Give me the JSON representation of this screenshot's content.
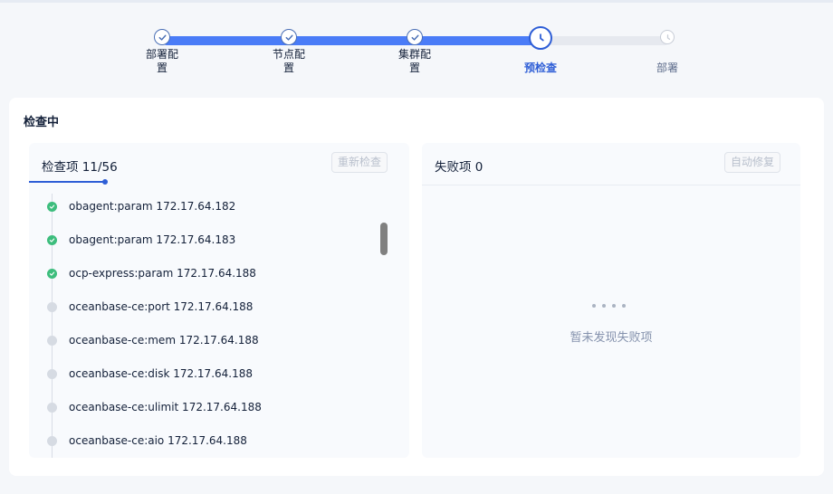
{
  "stepper": {
    "steps": [
      {
        "label_line1": "部署配",
        "label_line2": "置",
        "status": "done"
      },
      {
        "label_line1": "节点配",
        "label_line2": "置",
        "status": "done"
      },
      {
        "label_line1": "集群配",
        "label_line2": "置",
        "status": "done"
      },
      {
        "label_line1": "预检查",
        "label_line2": "",
        "status": "active"
      },
      {
        "label_line1": "部署",
        "label_line2": "",
        "status": "todo"
      }
    ]
  },
  "page": {
    "title": "检查中"
  },
  "check_panel": {
    "title": "检查项 11/56",
    "recheck_label": "重新检查",
    "items": [
      {
        "text": "obagent:param 172.17.64.182",
        "status": "done"
      },
      {
        "text": "obagent:param 172.17.64.183",
        "status": "done"
      },
      {
        "text": "ocp-express:param 172.17.64.188",
        "status": "done"
      },
      {
        "text": "oceanbase-ce:port 172.17.64.188",
        "status": "pending"
      },
      {
        "text": "oceanbase-ce:mem 172.17.64.188",
        "status": "pending"
      },
      {
        "text": "oceanbase-ce:disk 172.17.64.188",
        "status": "pending"
      },
      {
        "text": "oceanbase-ce:ulimit 172.17.64.188",
        "status": "pending"
      },
      {
        "text": "oceanbase-ce:aio 172.17.64.188",
        "status": "pending"
      }
    ]
  },
  "failed_panel": {
    "title": "失败项 0",
    "autofix_label": "自动修复",
    "empty_text": "暂未发现失败项"
  },
  "colors": {
    "accent": "#2e5ed6",
    "success": "#3dbd7d",
    "pending": "#d6dbe3"
  }
}
